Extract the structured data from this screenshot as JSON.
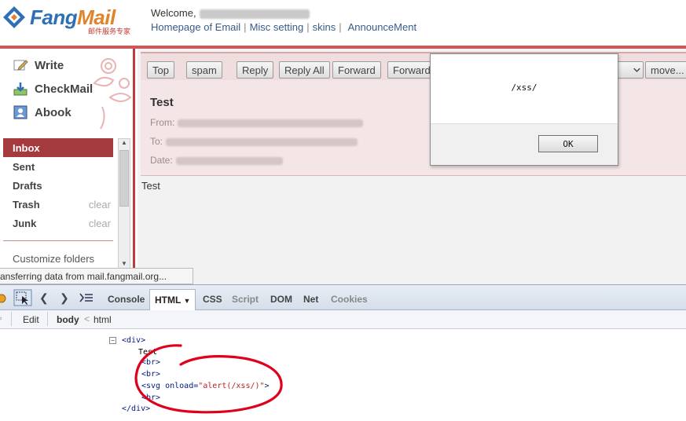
{
  "header": {
    "logo_text_a": "Fang",
    "logo_text_b": "Mail",
    "logo_sub": "邮件服务专家",
    "welcome_label": "Welcome,",
    "links": [
      "Homepage of Email",
      "Misc setting",
      "skins",
      "AnnounceMent"
    ],
    "link_separator": "|"
  },
  "sidebar": {
    "actions": [
      {
        "label": "Write",
        "icon": "pencil-icon"
      },
      {
        "label": "CheckMail",
        "icon": "download-icon"
      },
      {
        "label": "Abook",
        "icon": "address-book-icon"
      }
    ],
    "folders": [
      {
        "label": "Inbox",
        "active": true,
        "clear": ""
      },
      {
        "label": "Sent",
        "active": false,
        "clear": ""
      },
      {
        "label": "Drafts",
        "active": false,
        "clear": ""
      },
      {
        "label": "Trash",
        "active": false,
        "clear": "clear"
      },
      {
        "label": "Junk",
        "active": false,
        "clear": "clear"
      }
    ],
    "customize": "Customize folders"
  },
  "toolbar": {
    "buttons": [
      "Top",
      "spam",
      "Reply",
      "Reply All",
      "Forward",
      "Forward"
    ],
    "move_label": "move..."
  },
  "message": {
    "subject": "Test",
    "from_label": "From:",
    "to_label": "To:",
    "date_label": "Date:",
    "body": "Test"
  },
  "alert": {
    "message": "/xss/",
    "ok_label": "OK"
  },
  "status_bar": {
    "text": "ansferring data from mail.fangmail.org..."
  },
  "firebug": {
    "tabs": [
      "Console",
      "HTML",
      "CSS",
      "Script",
      "DOM",
      "Net",
      "Cookies"
    ],
    "active_tab": "HTML",
    "sub_edit": "Edit",
    "breadcrumb_body": "body",
    "breadcrumb_html": "html",
    "tree": {
      "div_open": "<div>",
      "text_test": "Test",
      "br1": "<br>",
      "br2": "<br>",
      "svg_pre": "<svg onload=",
      "svg_attr": "\"alert(/xss/)\"",
      "svg_post": ">",
      "br3": "<br>",
      "div_close": "</div>"
    }
  },
  "colors": {
    "accent": "#a43a3d",
    "header_bar": "#b22222",
    "link": "#3a5a8a",
    "annotation": "#e0001b"
  }
}
